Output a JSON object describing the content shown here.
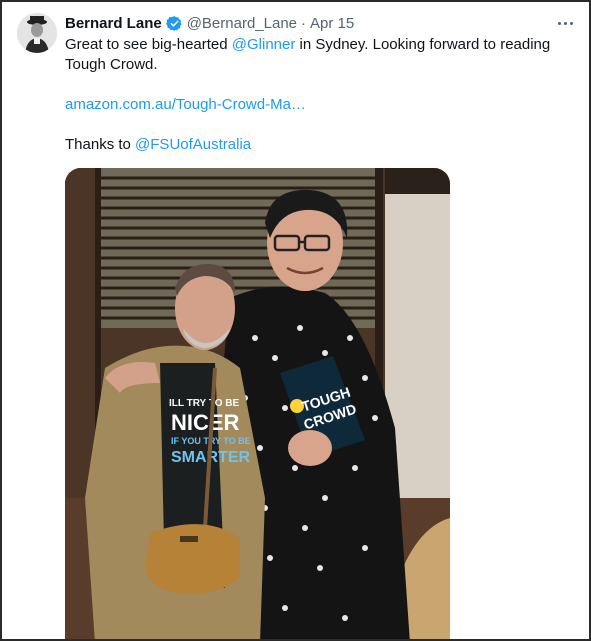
{
  "tweet": {
    "author_name": "Bernard Lane",
    "handle": "@Bernard_Lane",
    "separator": "·",
    "date": "Apr 15",
    "verified_icon": "verified-badge-icon",
    "more_icon": "more-options-icon",
    "text_before": "Great to see big-hearted ",
    "mention_1": "@Glinner",
    "text_after": " in Sydney. Looking forward to reading",
    "text_line2": "Tough Crowd.",
    "link_text": "amazon.com.au/Tough-Crowd-Ma…",
    "thanks_text": "Thanks to ",
    "mention_2": "@FSUofAustralia",
    "book_title_line1": "TOUGH",
    "book_title_line2": "CROWD",
    "shirt_line1": "ILL TRY TO BE",
    "shirt_line2": "NICER",
    "shirt_line3": "IF YOU TRY TO BE",
    "shirt_line4": "SMARTER"
  },
  "colors": {
    "link": "#1d9bf0",
    "verified": "#1d9bf0",
    "secondary_text": "#536471"
  }
}
